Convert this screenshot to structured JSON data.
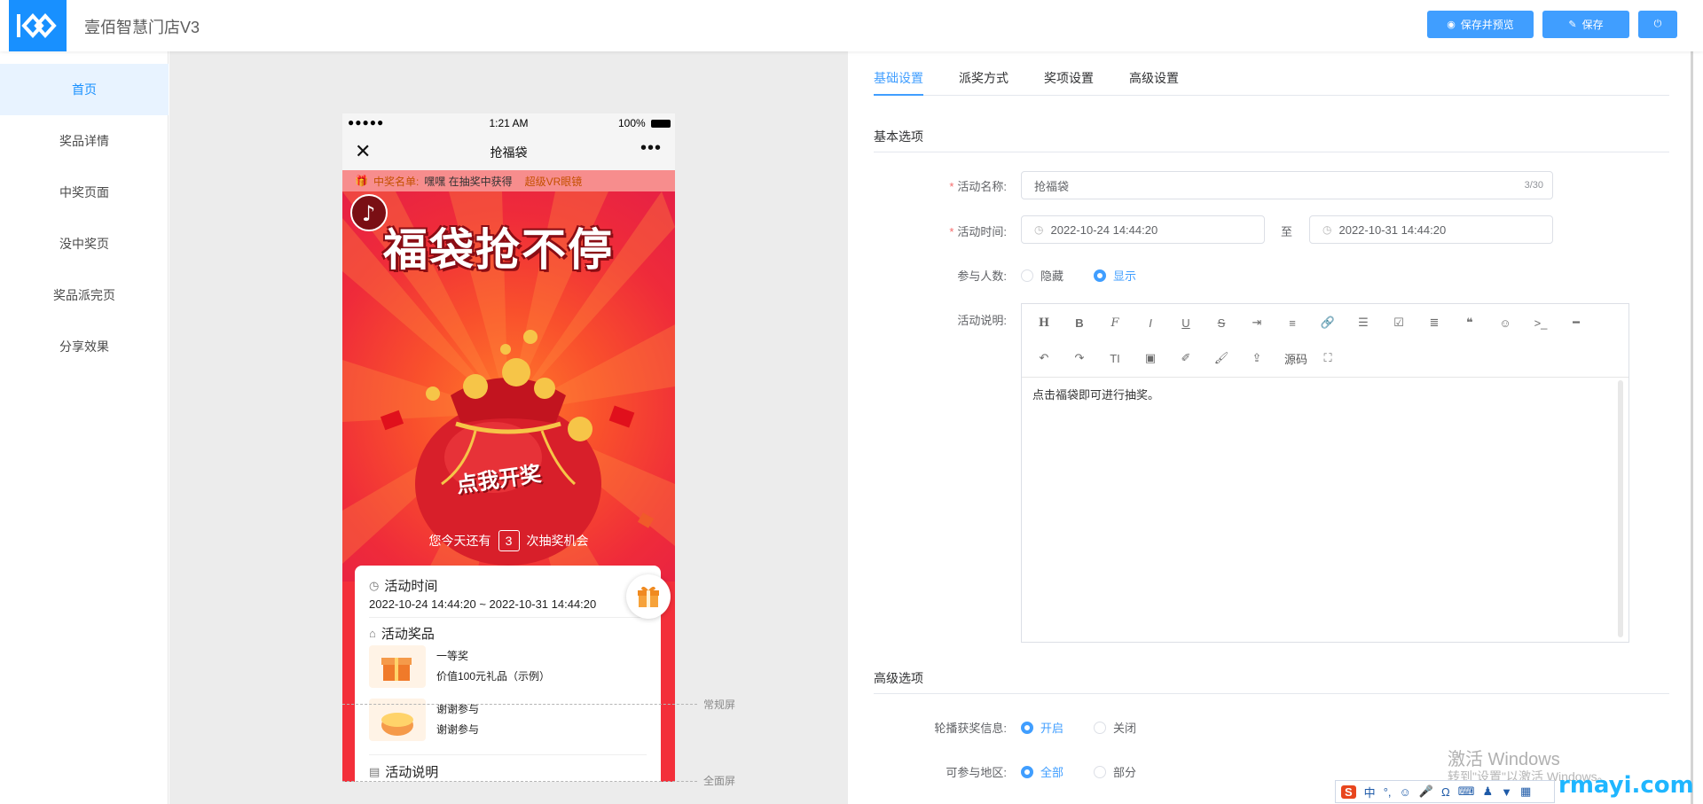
{
  "header": {
    "app_title": "壹佰智慧门店V3",
    "save_preview_label": "保存并预览",
    "save_label": "保存"
  },
  "sidebar": {
    "items": [
      {
        "label": "首页",
        "active": true
      },
      {
        "label": "奖品详情"
      },
      {
        "label": "中奖页面"
      },
      {
        "label": "没中奖页"
      },
      {
        "label": "奖品派完页"
      },
      {
        "label": "分享效果"
      }
    ]
  },
  "phone": {
    "status_time": "1:21 AM",
    "status_battery": "100%",
    "nav_title": "抢福袋",
    "ticker_label": "中奖名单:",
    "ticker_text": "嘿嘿 在抽奖中获得",
    "ticker_prize": "超级VR眼镜",
    "hero_title": "福袋抢不停",
    "bag_text": "点我开奖",
    "chance_prefix": "您今天还有",
    "chance_count": "3",
    "chance_suffix": "次抽奖机会",
    "time_heading": "活动时间",
    "time_range": "2022-10-24 14:44:20 ~ 2022-10-31 14:44:20",
    "prize_heading": "活动奖品",
    "prizes": [
      {
        "name": "一等奖",
        "desc": "价值100元礼品（示例）"
      },
      {
        "name": "谢谢参与",
        "desc": "谢谢参与"
      }
    ],
    "desc_heading": "活动说明"
  },
  "screen_labels": {
    "normal": "常规屏",
    "full": "全面屏"
  },
  "tabs": [
    {
      "label": "基础设置",
      "active": true
    },
    {
      "label": "派奖方式"
    },
    {
      "label": "奖项设置"
    },
    {
      "label": "高级设置"
    }
  ],
  "basic": {
    "section_title": "基本选项",
    "name_label": "活动名称:",
    "name_value": "抢福袋",
    "name_count": "3/30",
    "time_label": "活动时间:",
    "start_time": "2022-10-24 14:44:20",
    "to_label": "至",
    "end_time": "2022-10-31 14:44:20",
    "participants_label": "参与人数:",
    "participants_options": [
      "隐藏",
      "显示"
    ],
    "participants_selected": "显示",
    "desc_label": "活动说明:",
    "editor_source_label": "源码",
    "editor_text": "点击福袋即可进行抽奖。"
  },
  "advanced": {
    "section_title": "高级选项",
    "carousel_label": "轮播获奖信息:",
    "carousel_options": [
      "开启",
      "关闭"
    ],
    "region_label": "可参与地区:",
    "region_options": [
      "全部",
      "部分"
    ]
  },
  "overlay": {
    "activate_line1": "激活 Windows",
    "activate_line2": "转到\"设置\"以激活 Windows。",
    "brand": "rmayi.com",
    "ime_lang": "中"
  },
  "colors": {
    "primary": "#409eff",
    "logo": "#1890ff",
    "phone_bg": "#f32f3a"
  }
}
